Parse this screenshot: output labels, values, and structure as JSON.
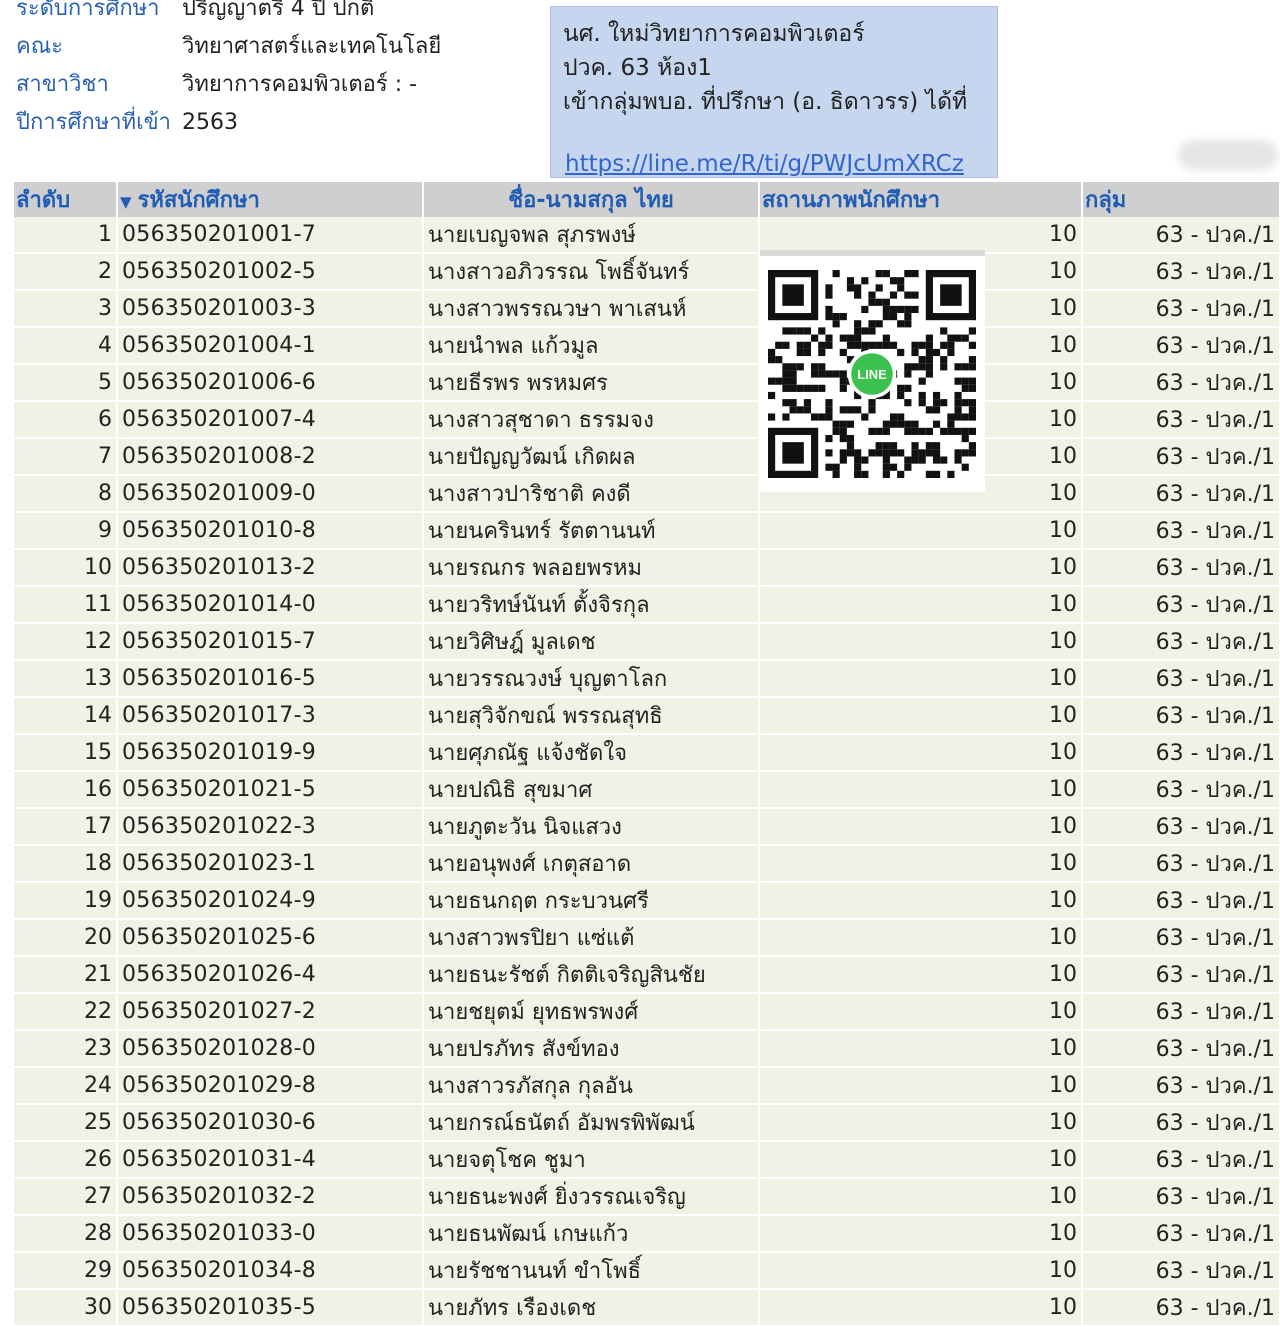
{
  "info": [
    {
      "label": "ระดับการศึกษา",
      "value": "ปริญญาตรี 4 ปี ปกติ"
    },
    {
      "label": "คณะ",
      "value": "วิทยาศาสตร์และเทคโนโลยี"
    },
    {
      "label": "สาขาวิชา",
      "value": "วิทยาการคอมพิวเตอร์ : -"
    },
    {
      "label": "ปีการศึกษาที่เข้า",
      "value": "2563"
    }
  ],
  "notice": {
    "line1": "นศ. ใหม่วิทยาการคอมพิวเตอร์",
    "line2": "ปวค. 63  ห้อง1",
    "line3": "เข้ากลุ่มพบอ. ที่ปรึกษา (อ. ธิดาวรร) ได้ที่",
    "link": "https://line.me/R/ti/g/PWJcUmXRCz"
  },
  "table": {
    "headers": {
      "no": "ลำดับ",
      "id": "รหัสนักศึกษา",
      "name": "ชื่อ-นามสกุล ไทย",
      "status": "สถานภาพนักศึกษา",
      "group": "กลุ่ม"
    },
    "rows": [
      {
        "no": "1",
        "id": "056350201001-7",
        "name": "นายเบญจพล สุภรพงษ์",
        "status": "10",
        "group": "63 - ปวค./1"
      },
      {
        "no": "2",
        "id": "056350201002-5",
        "name": "นางสาวอภิวรรณ โพธิ์จันทร์",
        "status": "10",
        "group": "63 - ปวค./1"
      },
      {
        "no": "3",
        "id": "056350201003-3",
        "name": "นางสาวพรรณวษา พาเสนห์",
        "status": "10",
        "group": "63 - ปวค./1"
      },
      {
        "no": "4",
        "id": "056350201004-1",
        "name": "นายนำพล แก้วมูล",
        "status": "10",
        "group": "63 - ปวค./1"
      },
      {
        "no": "5",
        "id": "056350201006-6",
        "name": "นายธีรพร พรหมศร",
        "status": "10",
        "group": "63 - ปวค./1"
      },
      {
        "no": "6",
        "id": "056350201007-4",
        "name": "นางสาวสุชาดา ธรรมจง",
        "status": "10",
        "group": "63 - ปวค./1"
      },
      {
        "no": "7",
        "id": "056350201008-2",
        "name": "นายปัญญวัฒน์ เกิดผล",
        "status": "10",
        "group": "63 - ปวค./1"
      },
      {
        "no": "8",
        "id": "056350201009-0",
        "name": "นางสาวปาริชาติ คงดี",
        "status": "10",
        "group": "63 - ปวค./1"
      },
      {
        "no": "9",
        "id": "056350201010-8",
        "name": "นายนครินทร์ รัตตานนท์",
        "status": "10",
        "group": "63 - ปวค./1"
      },
      {
        "no": "10",
        "id": "056350201013-2",
        "name": "นายรณกร พลอยพรหม",
        "status": "10",
        "group": "63 - ปวค./1"
      },
      {
        "no": "11",
        "id": "056350201014-0",
        "name": "นายวริทษ์นันท์ ตั้งจิรกุล",
        "status": "10",
        "group": "63 - ปวค./1"
      },
      {
        "no": "12",
        "id": "056350201015-7",
        "name": "นายวิศิษฎ์ มูลเดช",
        "status": "10",
        "group": "63 - ปวค./1"
      },
      {
        "no": "13",
        "id": "056350201016-5",
        "name": "นายวรรณวงษ์ บุญตาโลก",
        "status": "10",
        "group": "63 - ปวค./1"
      },
      {
        "no": "14",
        "id": "056350201017-3",
        "name": "นายสุวิจักขณ์ พรรณสุทธิ",
        "status": "10",
        "group": "63 - ปวค./1"
      },
      {
        "no": "15",
        "id": "056350201019-9",
        "name": "นายศุภณัฐ แจ้งชัดใจ",
        "status": "10",
        "group": "63 - ปวค./1"
      },
      {
        "no": "16",
        "id": "056350201021-5",
        "name": "นายปณิธิ สุขมาศ",
        "status": "10",
        "group": "63 - ปวค./1"
      },
      {
        "no": "17",
        "id": "056350201022-3",
        "name": "นายภูตะวัน นิจแสวง",
        "status": "10",
        "group": "63 - ปวค./1"
      },
      {
        "no": "18",
        "id": "056350201023-1",
        "name": "นายอนุพงศ์ เกตุสอาด",
        "status": "10",
        "group": "63 - ปวค./1"
      },
      {
        "no": "19",
        "id": "056350201024-9",
        "name": "นายธนกฤต กระบวนศรี",
        "status": "10",
        "group": "63 - ปวค./1"
      },
      {
        "no": "20",
        "id": "056350201025-6",
        "name": "นางสาวพรปิยา แซ่แต้",
        "status": "10",
        "group": "63 - ปวค./1"
      },
      {
        "no": "21",
        "id": "056350201026-4",
        "name": "นายธนะรัชต์ กิตติเจริญสินชัย",
        "status": "10",
        "group": "63 - ปวค./1"
      },
      {
        "no": "22",
        "id": "056350201027-2",
        "name": "นายชยุตม์ ยุทธพรพงศ์",
        "status": "10",
        "group": "63 - ปวค./1"
      },
      {
        "no": "23",
        "id": "056350201028-0",
        "name": "นายปรภัทร สังข์ทอง",
        "status": "10",
        "group": "63 - ปวค./1"
      },
      {
        "no": "24",
        "id": "056350201029-8",
        "name": "นางสาวรภัสกุล กุลอัน",
        "status": "10",
        "group": "63 - ปวค./1"
      },
      {
        "no": "25",
        "id": "056350201030-6",
        "name": "นายกรณ์ธนัตถ์ อัมพรพิพัฒน์",
        "status": "10",
        "group": "63 - ปวค./1"
      },
      {
        "no": "26",
        "id": "056350201031-4",
        "name": "นายจตุโชค ชูมา",
        "status": "10",
        "group": "63 - ปวค./1"
      },
      {
        "no": "27",
        "id": "056350201032-2",
        "name": "นายธนะพงศ์ ยิ่งวรรณเจริญ",
        "status": "10",
        "group": "63 - ปวค./1"
      },
      {
        "no": "28",
        "id": "056350201033-0",
        "name": "นายธนพัฒน์ เกษแก้ว",
        "status": "10",
        "group": "63 - ปวค./1"
      },
      {
        "no": "29",
        "id": "056350201034-8",
        "name": "นายรัชชานนท์ ขำโพธิ์",
        "status": "10",
        "group": "63 - ปวค./1"
      },
      {
        "no": "30",
        "id": "056350201035-5",
        "name": "นายภัทร เรืองเดช",
        "status": "10",
        "group": "63 - ปวค./1"
      }
    ]
  },
  "qr": {
    "badge": "LINE",
    "icon": "line-qr-code-icon"
  },
  "colors": {
    "link": "#2a62b3",
    "header_bg": "#cfcfcf",
    "row_bg": "#f1f1e6",
    "notice_bg": "#c6d6ee",
    "line_green": "#3cc14e"
  }
}
